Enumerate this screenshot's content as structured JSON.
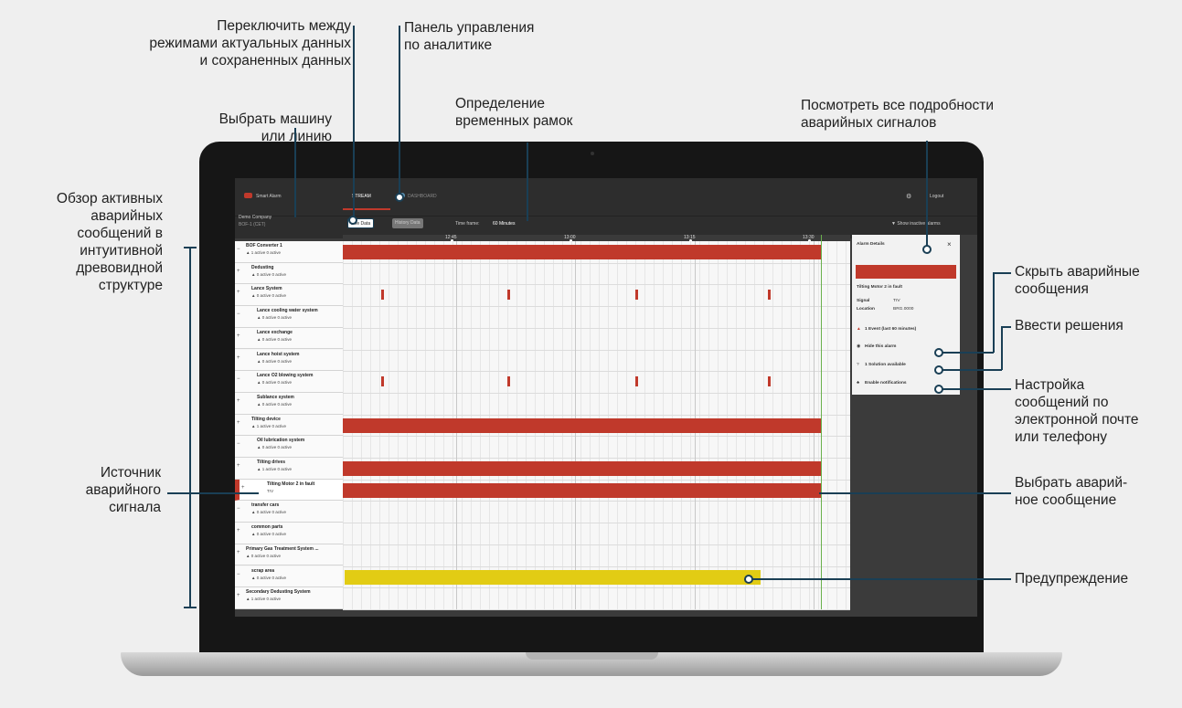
{
  "annotations": {
    "toggle_modes": [
      "Переключить между",
      "режимами актуальных данных",
      "и сохраненных данных"
    ],
    "analytics_panel": [
      "Панель управления",
      "по аналитике"
    ],
    "time_frame": [
      "Определение",
      "временных рамок"
    ],
    "select_machine": [
      "Выбрать машину",
      "или линию"
    ],
    "alarm_details": [
      "Посмотреть все подробности",
      "аварийных сигналов"
    ],
    "overview": [
      "Обзор активных",
      "аварийных",
      "сообщений в",
      "интуитивной",
      "древовидной",
      "структуре"
    ],
    "hide_alarms": [
      "Скрыть аварийные",
      "сообщения"
    ],
    "enter_solutions": [
      "Ввести решения"
    ],
    "notify_setup": [
      "Настройка",
      "сообщений по",
      "электронной почте",
      "или телефону"
    ],
    "alarm_source": [
      "Источник",
      "аварийного",
      "сигнала"
    ],
    "select_alarm": [
      "Выбрать аварий-",
      "ное сообщение"
    ],
    "warning": [
      "Предупреждение"
    ]
  },
  "app": {
    "brand": "Smart Alarm",
    "tab_stream": "STREAM",
    "tab_dashboard": "DASHBOARD",
    "logout": "Logout",
    "company": "Demo Company",
    "timezone": "BOF-1 (CET)",
    "live_data": "Live Data",
    "history_data": "History Data",
    "time_frame_label": "Time frame:",
    "time_frame_value": "60 Minutes",
    "show_inactive": "▼ Show inactive alarms",
    "time_ticks": [
      "12:45",
      "13:00",
      "13:15",
      "13:30"
    ],
    "tree": [
      {
        "name": "BOF Converter 1",
        "status": "1 active  0 active"
      },
      {
        "name": "Dedusting",
        "status": "0 active  0 active"
      },
      {
        "name": "Lance System",
        "status": "0 active  0 active"
      },
      {
        "name": "Lance cooling water system",
        "status": "0 active  0 active"
      },
      {
        "name": "Lance exchange",
        "status": "0 active  0 active"
      },
      {
        "name": "Lance hoist system",
        "status": "0 active  0 active"
      },
      {
        "name": "Lance O2 blowing system",
        "status": "0 active  0 active"
      },
      {
        "name": "Sublance system",
        "status": "0 active  0 active"
      },
      {
        "name": "Tilting device",
        "status": "1 active  0 active"
      },
      {
        "name": "Oil lubrication system",
        "status": "0 active  0 active"
      },
      {
        "name": "Tilting drives",
        "status": "1 active  0 active"
      },
      {
        "name": "Tilting Motor 2 in fault",
        "status": "TrV"
      },
      {
        "name": "transfer cars",
        "status": "0 active  0 active"
      },
      {
        "name": "common parts",
        "status": "0 active  0 active"
      },
      {
        "name": "Primary Gas Treatment System ...",
        "status": "0 active  0 active"
      },
      {
        "name": "scrap area",
        "status": "0 active  0 active"
      },
      {
        "name": "Secondary Dedusting System",
        "status": "1 active  0 active"
      }
    ],
    "detail": {
      "title": "Alarm Details",
      "close": "×",
      "alarm_name": "Tilting Motor 2 in fault",
      "signal_label": "Signal",
      "signal_value": "TrV",
      "location_label": "Location",
      "location_value": "BRG.0000",
      "events": "1 Event (last 60 minutes)",
      "hide": "Hide this alarm",
      "solutions": "1 Solution available",
      "notify": "Enable notifications"
    }
  },
  "colors": {
    "alarm": "#c0392b",
    "warning": "#e2cc14",
    "accent": "#1a3f55",
    "now": "#6ab04c"
  }
}
